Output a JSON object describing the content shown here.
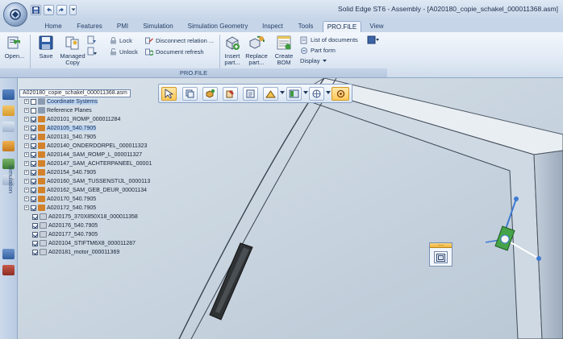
{
  "window": {
    "title": "Solid Edge ST6 - Assembly - [A020180_copie_schakel_000011368.asm]"
  },
  "quick_access": {
    "items": [
      "save-icon",
      "undo-icon",
      "redo-icon",
      "customize-icon"
    ]
  },
  "tabs": [
    {
      "label": "Home",
      "active": false
    },
    {
      "label": "Features",
      "active": false
    },
    {
      "label": "PMI",
      "active": false
    },
    {
      "label": "Simulation",
      "active": false
    },
    {
      "label": "Simulation Geometry",
      "active": false
    },
    {
      "label": "Inspect",
      "active": false
    },
    {
      "label": "Tools",
      "active": false
    },
    {
      "label": "PRO.FILE",
      "active": true
    },
    {
      "label": "View",
      "active": false
    }
  ],
  "ribbon": {
    "group_caption": "PRO.FILE",
    "open": "Open...",
    "save": "Save",
    "managed_copy": "Managed\nCopy",
    "lock": "Lock",
    "unlock": "Unlock",
    "disconnect_relation": "Disconnect relation ...",
    "document_refresh": "Document refresh",
    "insert_part": "Insert\npart...",
    "replace_part": "Replace\npart...",
    "create_bom": "Create\nBOM",
    "list_of_documents": "List of documents",
    "part_form": "Part form",
    "display": "Display"
  },
  "left_strip": {
    "vertical_tab": "Simulation"
  },
  "tree": {
    "root": "A020180_copie_schakel_000011368.asm",
    "items": [
      {
        "label": "Coordinate Systems",
        "expand": true,
        "checked": false,
        "color": "#8a9ab0",
        "selected": true
      },
      {
        "label": "Reference Planes",
        "expand": true,
        "checked": false,
        "color": "#8a9ab0",
        "selected": false
      },
      {
        "label": "A020101_ROMP_000011284",
        "expand": true,
        "checked": true,
        "color": "#d2822a",
        "selected": false
      },
      {
        "label": "A020105_540.7905",
        "expand": true,
        "checked": true,
        "color": "#d2822a",
        "selected": true
      },
      {
        "label": "A020131_540.7905",
        "expand": true,
        "checked": true,
        "color": "#d2822a",
        "selected": false
      },
      {
        "label": "A020140_ONDERDORPEL_000011323",
        "expand": true,
        "checked": true,
        "color": "#d2822a",
        "selected": false
      },
      {
        "label": "A020144_SAM_ROMP_L_000011327",
        "expand": true,
        "checked": true,
        "color": "#d2822a",
        "selected": false
      },
      {
        "label": "A020147_SAM_ACHTERPANEEL_00001",
        "expand": true,
        "checked": true,
        "color": "#d2822a",
        "selected": false
      },
      {
        "label": "A020154_540.7905",
        "expand": true,
        "checked": true,
        "color": "#d2822a",
        "selected": false
      },
      {
        "label": "A020160_SAM_TUSSENSTIJL_0000113",
        "expand": true,
        "checked": true,
        "color": "#d2822a",
        "selected": false
      },
      {
        "label": "A020162_SAM_GEB_DEUR_00001134",
        "expand": true,
        "checked": true,
        "color": "#d2822a",
        "selected": false
      },
      {
        "label": "A020170_540.7905",
        "expand": true,
        "checked": true,
        "color": "#d2822a",
        "selected": false
      },
      {
        "label": "A020172_540.7905",
        "expand": true,
        "checked": true,
        "color": "#d2822a",
        "selected": false
      },
      {
        "label": "A020175_370X850X18_000011358",
        "expand": false,
        "checked": true,
        "color": "#c9cfd9",
        "selected": false
      },
      {
        "label": "A020176_540.7905",
        "expand": false,
        "checked": true,
        "color": "#c9cfd9",
        "selected": false
      },
      {
        "label": "A020177_540.7905",
        "expand": false,
        "checked": true,
        "color": "#c9cfd9",
        "selected": false
      },
      {
        "label": "A020104_STIFTM6X8_000011287",
        "expand": false,
        "checked": true,
        "color": "#c9cfd9",
        "selected": false
      },
      {
        "label": "A020181_motor_000011369",
        "expand": false,
        "checked": true,
        "color": "#c9cfd9",
        "selected": false
      }
    ]
  },
  "command_bar": {
    "buttons": [
      "select-tool-icon",
      "select-box-icon",
      "part-add-icon",
      "edit-definition-icon",
      "properties-icon",
      "view-options-icon",
      "display-options-icon",
      "steering-wheel-icon"
    ]
  },
  "mini_toolbar": {
    "grip": "....",
    "button": "frame-icon"
  }
}
